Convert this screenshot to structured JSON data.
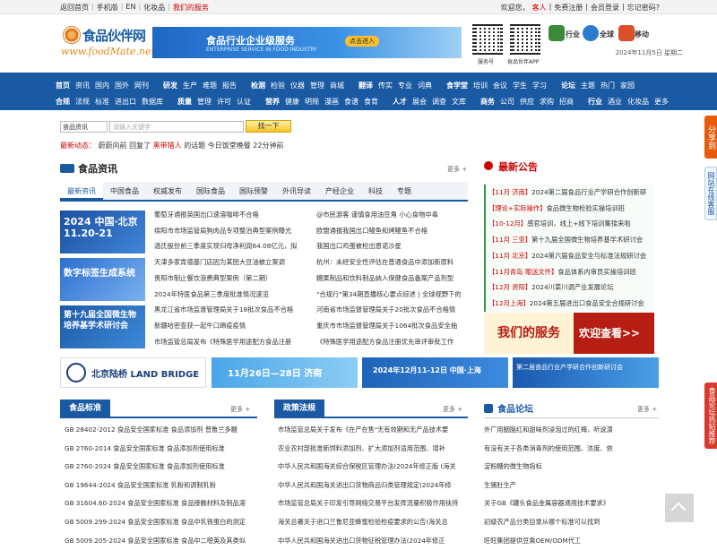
{
  "topbar": {
    "left": [
      "返回首页",
      "手机版",
      "EN",
      "化妆品",
      "我们的服务"
    ],
    "right": [
      "欢迎您，",
      "客人",
      "免费注册",
      "会员登录",
      "忘记密码?"
    ]
  },
  "logo": {
    "cn": "食品伙伴网",
    "en": "www.foodMate.net"
  },
  "banner": {
    "title": "食品行业企业级服务",
    "sub": "ENTERPRISE SERVICE IN FOOD INDUSTRY",
    "btn": "点击进入"
  },
  "qr": [
    "服务号",
    "食品伙伴APP"
  ],
  "quick": [
    "行业",
    "全球",
    "移动"
  ],
  "date": "2024年11月5日 星期二",
  "nav": {
    "row1": [
      [
        "首页",
        "资讯",
        "国内",
        "国外",
        "网刊"
      ],
      [
        "研发",
        "生产",
        "难题",
        "报告"
      ],
      [
        "检测",
        "检验",
        "仪器",
        "管理",
        "商城"
      ],
      [
        "翻译",
        "传实",
        "专业",
        "词典"
      ],
      [
        "食学堂",
        "培训",
        "会议",
        "学生",
        "学习"
      ],
      [
        "论坛",
        "主题",
        "热门",
        "家园"
      ]
    ],
    "row2": [
      [
        "合规",
        "法规",
        "标准",
        "进出口",
        "数据库"
      ],
      [
        "质量",
        "管理",
        "许可",
        "认证"
      ],
      [
        "营养",
        "健康",
        "明规",
        "漫画",
        "食谱",
        "食育"
      ],
      [
        "人才",
        "展会",
        "调查",
        "文库"
      ],
      [
        "商务",
        "公司",
        "供应",
        "求购",
        "招商"
      ],
      [
        "行业",
        "酒业",
        "化妆品",
        "更多"
      ]
    ]
  },
  "search": {
    "select": "食品资讯",
    "placeholder": "请输入关键字",
    "btn": "找一下"
  },
  "dynamic": {
    "label": "最新动态：",
    "user": "蔚蔚向前",
    "act": "回复了",
    "target": "黑带猎人",
    "rest": "的话题",
    "topic": "今日饭堂晚餐",
    "time": "22分钟前"
  },
  "news": {
    "title": "食品资讯",
    "more": "更多 +",
    "tabs": [
      "最新资讯",
      "中国食品",
      "权威发布",
      "国际食品",
      "国际预警",
      "外讯导读",
      "产经企业",
      "科技",
      "专题"
    ],
    "col1": [
      "葡萄牙通报英国出口速溶咖啡不合格",
      "绵阳市市场监管局狗肉品专项整治典型案例曝光",
      "温氏股份前三季度实现归母净利润64.08亿元，拟",
      "天津多家肯德基门店因为某团大豆油被立案调",
      "贵阳市制止餐饮浪费典型案例（第二期）",
      "2024年特医食品第三季度批准情况速览",
      "黑龙江省市场监督管理局关于18批次食品不合格",
      "新疆哈密查获一起牛口蹄疫疫情",
      "市场监管总局发布《特殊医学用途配方食品注册"
    ],
    "col2": [
      "@市民游客 谨慎食用油豆角 小心食物中毒",
      "欧盟通报我国出口鳗鱼和烤鳗鱼不合格",
      "我国出口鸡蛋被检出恩诺沙星",
      "杭州：未经安全性评估在普通食品中添加新原料",
      "糖果制品和饮料制品纳入保健食品备案产品剂型",
      "\"合规行\"第34期直播核心要点综述 | 全球视野下的",
      "河南省市场监督管理局关于20批次食品不合格情",
      "重庆市市场监督管理局关于1064批次食品安全抽",
      "《特殊医学用途配方食品注册优先审评审批工作"
    ]
  },
  "ads": [
    "2024 中国·北京 11.20-21",
    "数字标签生成系统",
    "第十九届全国微生物培养基学术研讨会"
  ],
  "notice": {
    "title": "最新公告",
    "items": [
      [
        "【11月 济南】",
        "2024第二届食品行业产学研合作创新研"
      ],
      [
        "【理论+实际操作】",
        "食品微生物检验实操培训班"
      ],
      [
        "【10-12月】",
        "感官培训，线上+线下培训集锦来啦"
      ],
      [
        "【11月 三亚】",
        "第十九届全国微生物培养基学术研讨会"
      ],
      [
        "【11月 北京】",
        "2024第六届食品安全与标准法规研讨会"
      ],
      [
        "【11月青岛 赠送文件】",
        "食品体系内审员实操培训班"
      ],
      [
        "【12月 资阳】",
        "2024川菜川调产业发展论坛"
      ],
      [
        "【12月上海】",
        "2024第五届进出口食品安全合规研讨会"
      ]
    ]
  },
  "service": {
    "a": "我们的服务",
    "b": "欢迎查看>>"
  },
  "strips": [
    "北京陆桥 LAND BRIDGE",
    "11月26日—28日 济南",
    "2024年12月11-12日 中国·上海",
    "第二届食品行业产学研合作创新研讨会"
  ],
  "standard": {
    "title": "食品标准",
    "more": "更多 +",
    "items": [
      "GB 28402-2012 食品安全国家标准 食品添加剂 普鲁兰多糖",
      "GB 2760-2014 食品安全国家标准 食品添加剂使用标准",
      "GB 2760-2024 食品安全国家标准 食品添加剂使用标准",
      "GB 19644-2024 食品安全国家标准 乳粉和调制乳粉",
      "GB 31604.60-2024 食品安全国家标准 食品接触材料及制品溶",
      "GB 5009.299-2024 食品安全国家标准 食品中乳铁蛋白的测定",
      "GB 5009.205-2024 食品安全国家标准 食品中二噁英及其类似"
    ]
  },
  "law": {
    "title": "政策法规",
    "more": "更多 +",
    "items": [
      "市场监管总局关于发布《在产在售\"无有效期和无产品技术要",
      "农业农村部批准新饲料添加剂、扩大添加剂适用范围、增补",
      "中华人民共和国海关综合保税区管理办法(2024年修正版 (海关",
      "中华人民共和国海关进出口货物商品归类管理规定(2024年修",
      "市场监管总局关于印发引导网络交易平台发挥流量积极作用扶持",
      "海关总署关于进口兰鲁尼亚蜂蜜检验检疫要求的公告(海关总",
      "中华人民共和国海关进出口货物征税管理办法(2024年修正"
    ]
  },
  "forum": {
    "title": "食品论坛",
    "more": "更多 +",
    "items": [
      "外厂用胭脂红和甜味剂浸泡过的红梅，听说演",
      "有没有关于各类消毒剂的使用范围、浓度、依",
      "淀粉糖的微生物指标",
      "生猪肚生产",
      "关于GB《罐头食品金属容器通用技术要求》",
      "初级农产品分类目录从哪个标准可以找到",
      "旺旺集团提供豆乘OEM/ODM代工"
    ]
  },
  "side": {
    "share": "分享到",
    "help": "网站在线客服",
    "forum": "食品论坛热帖推荐"
  }
}
